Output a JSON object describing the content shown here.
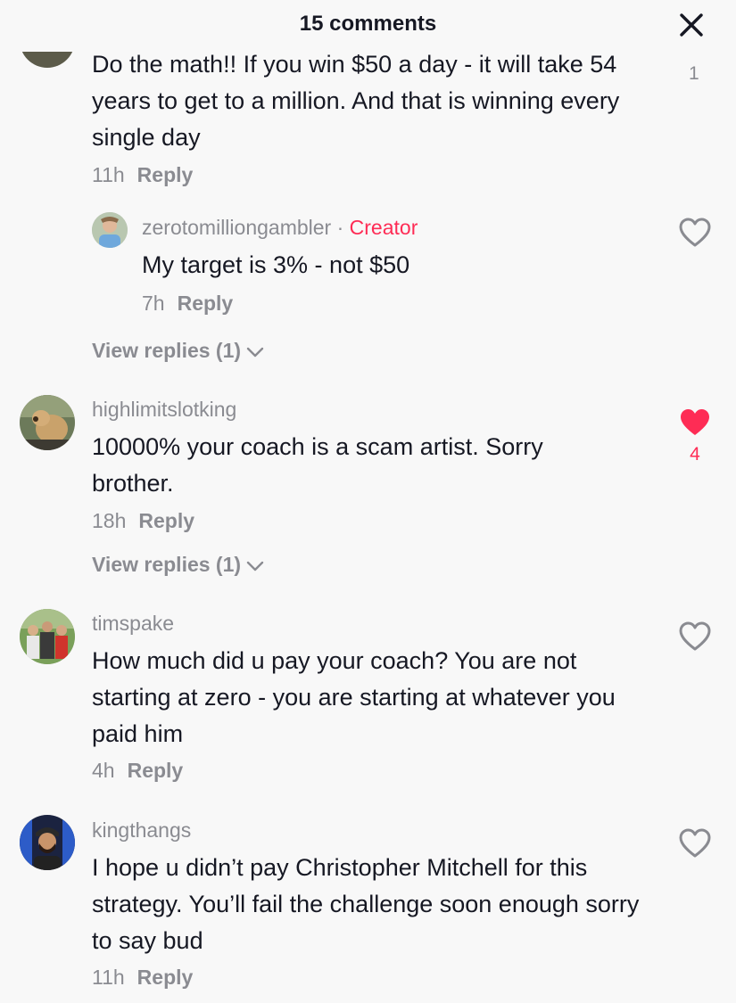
{
  "header": {
    "title": "15 comments"
  },
  "top_comment": {
    "text": "Do the math!! If you win $50 a day - it will take 54 years to get to a million. And that is winning every single day",
    "time": "11h",
    "reply_label": "Reply",
    "like_count": "1"
  },
  "creator_reply": {
    "username": "zerotomilliongambler",
    "separator": "·",
    "creator_label": "Creator",
    "text": "My target is 3% - not $50",
    "time": "7h",
    "reply_label": "Reply"
  },
  "view_replies_1": "View replies (1)",
  "comments": [
    {
      "username": "highlimitslotking",
      "text": "10000% your coach is a scam artist. Sorry brother.",
      "time": "18h",
      "reply_label": "Reply",
      "like_count": "4",
      "liked": true,
      "view_replies": "View replies (1)"
    },
    {
      "username": "timspake",
      "text": "How much did u pay your coach? You are not starting at zero - you are starting at whatever you paid him",
      "time": "4h",
      "reply_label": "Reply"
    },
    {
      "username": "kingthangs",
      "text": "I hope u didn’t pay Christopher Mitchell for this strategy. You’ll fail the challenge soon enough sorry to say bud",
      "time": "11h",
      "reply_label": "Reply"
    }
  ],
  "colors": {
    "accent": "#fe2c55",
    "secondary_text": "#8a8b91",
    "primary_text": "#161823",
    "background": "#f8f8f8"
  },
  "icons": [
    "close-icon",
    "heart-outline-icon",
    "heart-filled-icon",
    "chevron-down-icon"
  ]
}
